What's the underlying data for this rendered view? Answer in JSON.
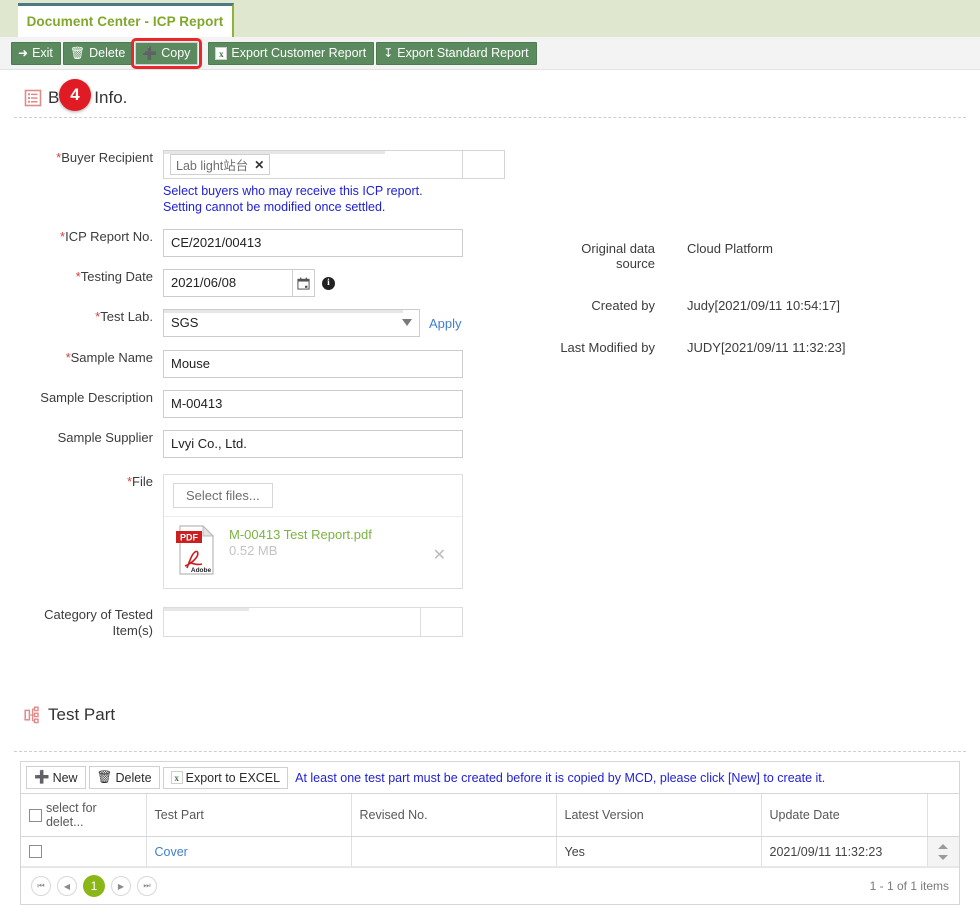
{
  "tab": {
    "title": "Document Center - ICP Report"
  },
  "toolbar": {
    "buttons": [
      {
        "label": "Exit",
        "icon": "exit-icon"
      },
      {
        "label": "Delete",
        "icon": "delete-icon"
      },
      {
        "label": "Copy",
        "icon": "plus-icon"
      },
      {
        "label": "Export Customer Report",
        "icon": "excel-icon"
      },
      {
        "label": "Export Standard Report",
        "icon": "download-icon"
      }
    ],
    "step_badge": "4",
    "highlight_color": "#e8282a"
  },
  "basic_info": {
    "section_title": "Basic Info.",
    "buyer_recipient": {
      "label": "Buyer Recipient",
      "required": true,
      "chip": "Lab light站台",
      "chip_remove": "✕",
      "hint": "Select buyers who may receive this ICP report. Setting cannot be modified once settled."
    },
    "icp_report_no": {
      "label": "ICP Report No.",
      "required": true,
      "value": "CE/2021/00413"
    },
    "testing_date": {
      "label": "Testing Date",
      "required": true,
      "value": "2021/06/08",
      "info": "i"
    },
    "test_lab": {
      "label": "Test Lab.",
      "required": true,
      "value": "SGS",
      "apply_link": "Apply"
    },
    "sample_name": {
      "label": "Sample Name",
      "required": true,
      "value": "Mouse"
    },
    "sample_description": {
      "label": "Sample Description",
      "required": false,
      "value": "M-00413"
    },
    "sample_supplier": {
      "label": "Sample Supplier",
      "required": false,
      "value": "Lvyi Co., Ltd."
    },
    "file": {
      "label": "File",
      "required": true,
      "select_files_label": "Select files...",
      "name": "M-00413 Test Report.pdf",
      "size": "0.52 MB",
      "badge": "PDF",
      "brand": "Adobe",
      "remove": "✕"
    },
    "category": {
      "label_line1": "Category of Tested",
      "label_line2": "Item(s)",
      "value": ""
    },
    "meta": [
      {
        "label": "Original data source",
        "value": "Cloud Platform"
      },
      {
        "label": "Created by",
        "value": "Judy[2021/09/11 10:54:17]"
      },
      {
        "label": "Last Modified by",
        "value": "JUDY[2021/09/11 11:32:23]"
      }
    ]
  },
  "test_part": {
    "section_title": "Test Part",
    "toolbar": {
      "new_label": "New",
      "delete_label": "Delete",
      "export_label": "Export to EXCEL",
      "message": "At least one test part must be created before it is copied by MCD, please click [New] to create it."
    },
    "columns": [
      "select for delet...",
      "Test Part",
      "Revised No.",
      "Latest Version",
      "Update Date"
    ],
    "rows": [
      {
        "test_part": "Cover",
        "revised_no": "",
        "latest_version": "Yes",
        "update_date": "2021/09/11 11:32:23"
      }
    ],
    "pager": {
      "first": "◀│",
      "prev": "◀",
      "page": "1",
      "next": "▶",
      "last": "│▶",
      "info": "1 - 1 of 1 items"
    }
  }
}
